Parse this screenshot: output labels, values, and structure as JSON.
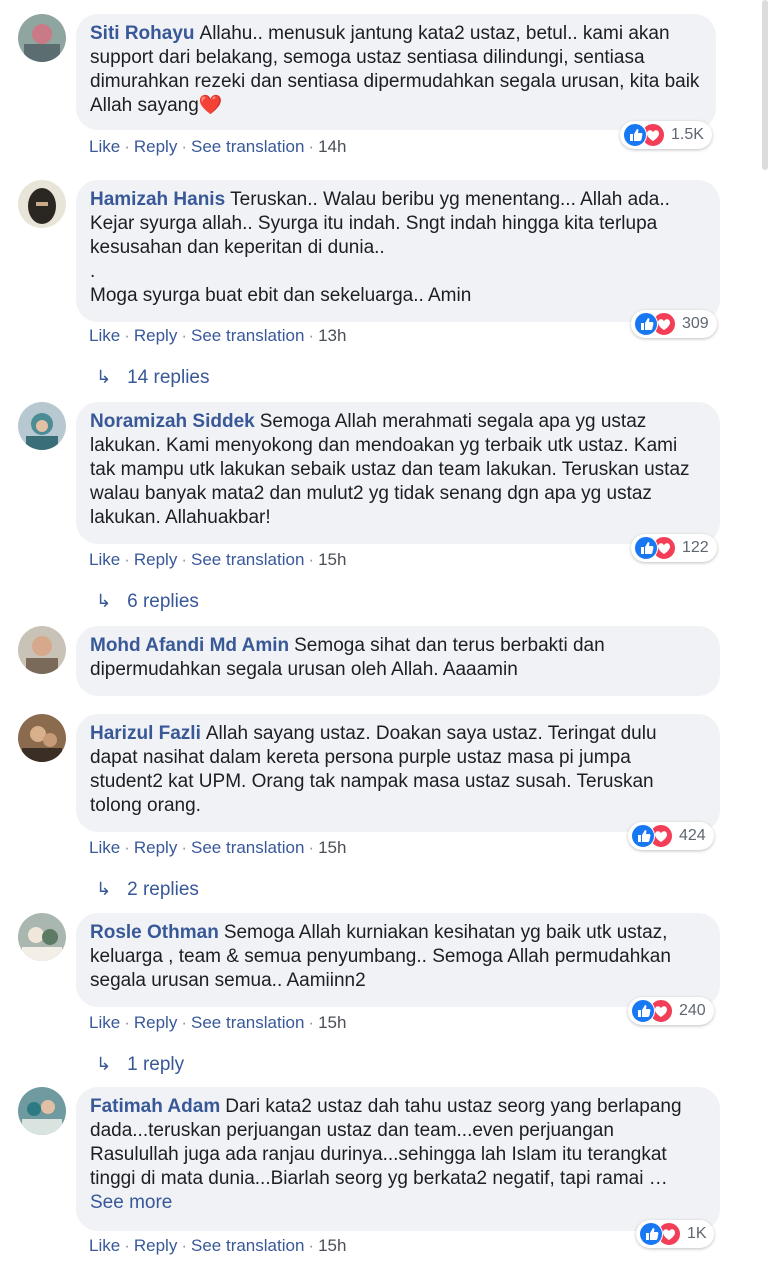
{
  "actions": {
    "like": "Like",
    "reply": "Reply",
    "see_translation": "See translation",
    "dot": "·"
  },
  "comments": [
    {
      "author": "Siti Rohayu",
      "text": "Allahu.. menusuk jantung kata2 ustaz, betul.. kami akan support dari belakang, semoga ustaz sentiasa dilindungi, sentiasa dimurahkan rezeki dan sentiasa dipermudahkan segala urusan, kita baik Allah sayang❤️",
      "time": "14h",
      "reactions": "1.5K"
    },
    {
      "author": "Hamizah Hanis",
      "text": "Teruskan.. Walau beribu yg menentang... Allah ada.. Kejar syurga allah.. Syurga itu indah. Sngt indah hingga kita terlupa kesusahan dan keperitan di dunia..\n.\nMoga syurga buat ebit dan sekeluarga.. Amin",
      "time": "13h",
      "reactions": "309",
      "replies": "14 replies"
    },
    {
      "author": "Noramizah Siddek",
      "text": "Semoga Allah merahmati segala apa yg ustaz lakukan. Kami menyokong dan mendoakan yg terbaik utk ustaz. Kami tak mampu utk lakukan sebaik ustaz dan team lakukan. Teruskan ustaz walau banyak mata2 dan mulut2 yg tidak senang dgn apa yg ustaz lakukan. Allahuakbar!",
      "time": "15h",
      "reactions": "122",
      "replies": "6 replies"
    },
    {
      "author": "Mohd Afandi Md Amin",
      "text": "Semoga sihat dan terus berbakti dan dipermudahkan segala urusan oleh Allah. Aaaamin"
    },
    {
      "author": "Harizul Fazli",
      "text": "Allah sayang ustaz. Doakan saya ustaz. Teringat dulu dapat nasihat dalam kereta persona purple ustaz masa pi jumpa student2 kat UPM. Orang tak nampak masa ustaz susah. Teruskan tolong orang.",
      "time": "15h",
      "reactions": "424",
      "replies": "2 replies"
    },
    {
      "author": "Rosle Othman",
      "text": "Semoga Allah kurniakan kesihatan yg baik utk ustaz, keluarga , team & semua penyumbang.. Semoga Allah permudahkan segala urusan semua.. Aamiinn2",
      "time": "15h",
      "reactions": "240",
      "replies": "1 reply"
    },
    {
      "author": "Fatimah Adam",
      "text": "Dari kata2 ustaz dah tahu ustaz seorg yang berlapang dada...teruskan perjuangan ustaz dan team...even perjuangan Rasulullah juga ada ranjau durinya...sehingga lah Islam itu terangkat tinggi di mata dunia...Biarlah seorg yg berkata2 negatif, tapi ramai …",
      "see_more": "See more",
      "time": "15h",
      "reactions": "1K"
    }
  ],
  "colors": {
    "link": "#385898",
    "bubble": "#f0f2f5",
    "like_blue": "#1877f2",
    "love_red": "#f33e58"
  }
}
